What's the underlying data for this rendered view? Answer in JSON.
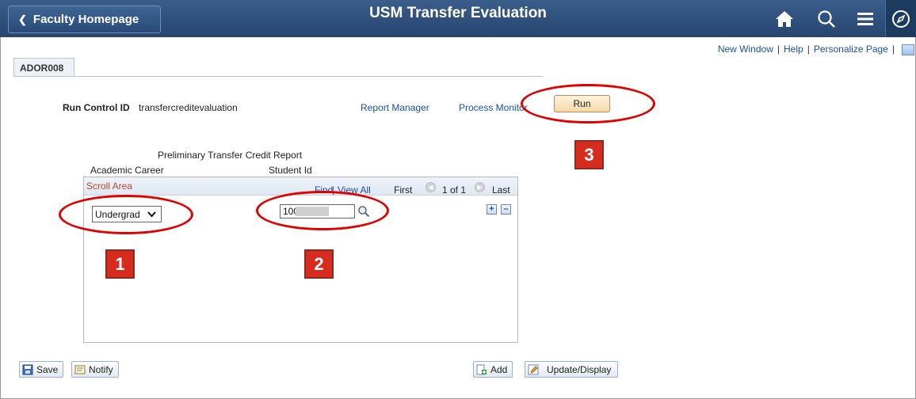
{
  "header": {
    "back_label": "Faculty Homepage",
    "title": "USM Transfer Evaluation",
    "icons": [
      "home-icon",
      "search-icon",
      "menu-icon",
      "navigator-icon"
    ]
  },
  "top_links": {
    "new_window": "New Window",
    "help": "Help",
    "personalize": "Personalize Page",
    "sep": "|"
  },
  "tab": {
    "label": "ADOR008"
  },
  "run_control": {
    "label": "Run Control ID",
    "value": "transfercreditevaluation",
    "report_manager": "Report Manager",
    "process_monitor": "Process Monitor",
    "run_label": "Run"
  },
  "form": {
    "section_title": "Preliminary Transfer Credit Report",
    "academic_career_label": "Academic Career",
    "student_id_label": "Student Id",
    "scroll_title": "Scroll Area",
    "find": "Find",
    "view_all": "View All",
    "first": "First",
    "page_info": "1 of 1",
    "last": "Last",
    "career_value": "Undergrad",
    "student_id_value": "100"
  },
  "annotations": {
    "one": "1",
    "two": "2",
    "three": "3",
    "color": "#e00000"
  },
  "toolbar": {
    "save": "Save",
    "notify": "Notify",
    "add": "Add",
    "update_display": "Update/Display"
  }
}
